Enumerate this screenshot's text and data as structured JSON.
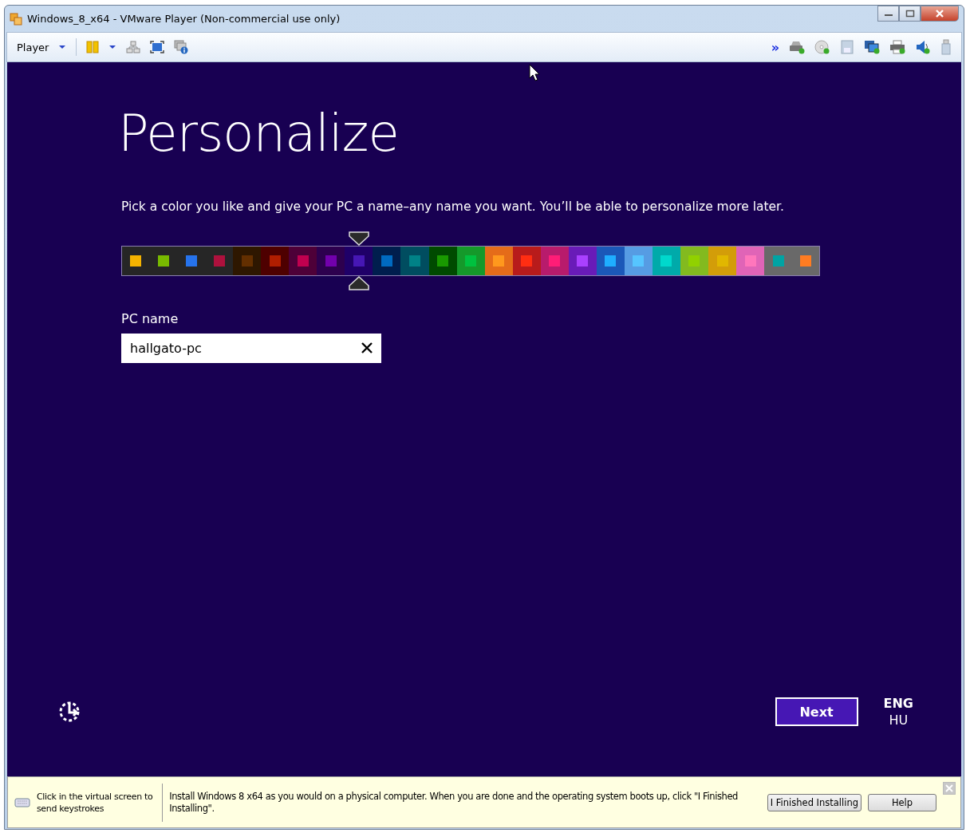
{
  "window": {
    "title": "Windows_8_x64 - VMware Player (Non-commercial use only)"
  },
  "toolbar": {
    "menu": "Player",
    "overflow": "»"
  },
  "setup": {
    "heading": "Personalize",
    "instruction": "Pick a color you like and give your PC a name–any name you want. You’ll be able to personalize more later.",
    "colors": [
      {
        "color": "#262626",
        "swatch": {
          "color": "#f4b300"
        },
        "selected": false
      },
      {
        "color": "#262626",
        "swatch": {
          "color": "#78ba00"
        },
        "selected": false
      },
      {
        "color": "#262626",
        "swatch": {
          "color": "#2673ec"
        },
        "selected": false
      },
      {
        "color": "#262626",
        "swatch": {
          "color": "#ae113d"
        },
        "selected": false
      },
      {
        "color": "#2e1700",
        "swatch": {
          "color": "#632f00"
        },
        "selected": false
      },
      {
        "color": "#4e0000",
        "swatch": {
          "color": "#b01e00"
        },
        "selected": false
      },
      {
        "color": "#4e0038",
        "swatch": {
          "color": "#c1004f"
        },
        "selected": false
      },
      {
        "color": "#2d004e",
        "swatch": {
          "color": "#7200ac"
        },
        "selected": false
      },
      {
        "color": "#1f0068",
        "swatch": {
          "color": "#4617b4"
        },
        "selected": true
      },
      {
        "color": "#001e4e",
        "swatch": {
          "color": "#006ac1"
        },
        "selected": false
      },
      {
        "color": "#004d60",
        "swatch": {
          "color": "#008287"
        },
        "selected": false
      },
      {
        "color": "#004a00",
        "swatch": {
          "color": "#199900"
        },
        "selected": false
      },
      {
        "color": "#15992a",
        "swatch": {
          "color": "#00c13f"
        },
        "selected": false
      },
      {
        "color": "#e56c19",
        "swatch": {
          "color": "#ff981d"
        },
        "selected": false
      },
      {
        "color": "#b81b1b",
        "swatch": {
          "color": "#ff2e12"
        },
        "selected": false
      },
      {
        "color": "#b81b6c",
        "swatch": {
          "color": "#ff1d77"
        },
        "selected": false
      },
      {
        "color": "#691bb8",
        "swatch": {
          "color": "#aa40ff"
        },
        "selected": false
      },
      {
        "color": "#1b58b8",
        "swatch": {
          "color": "#1faeff"
        },
        "selected": false
      },
      {
        "color": "#569ce3",
        "swatch": {
          "color": "#56c5ff"
        },
        "selected": false
      },
      {
        "color": "#00aaaa",
        "swatch": {
          "color": "#00d8cc"
        },
        "selected": false
      },
      {
        "color": "#83ba1f",
        "swatch": {
          "color": "#91d100"
        },
        "selected": false
      },
      {
        "color": "#d39d09",
        "swatch": {
          "color": "#e1b700"
        },
        "selected": false
      },
      {
        "color": "#e064b7",
        "swatch": {
          "color": "#ff76bc"
        },
        "selected": false
      },
      {
        "color": "#696969",
        "swatch": {
          "color": "#00a3a3"
        },
        "selected": false
      },
      {
        "color": "#696969",
        "swatch": {
          "color": "#fe7c22"
        },
        "selected": false
      }
    ],
    "pc_name": {
      "label": "PC name",
      "value": "hallgato-pc"
    },
    "next_button": "Next",
    "language": {
      "code": "ENG",
      "layout": "HU"
    }
  },
  "info_bar": {
    "hint": "Click in the virtual screen to send keystrokes",
    "message": "Install Windows 8 x64 as you would on a physical computer. When you are done and the operating system boots up, click \"I Finished Installing\".",
    "buttons": [
      "I Finished Installing",
      "Help"
    ]
  }
}
